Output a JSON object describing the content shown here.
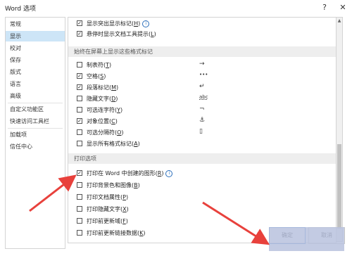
{
  "window": {
    "title": "Word 选项",
    "help": "?",
    "close": "✕"
  },
  "sidebar": {
    "items": [
      {
        "label": "常规"
      },
      {
        "label": "显示"
      },
      {
        "label": "校对"
      },
      {
        "label": "保存"
      },
      {
        "label": "版式"
      },
      {
        "label": "语言"
      },
      {
        "label": "高级"
      },
      {
        "label": "自定义功能区"
      },
      {
        "label": "快速访问工具栏"
      },
      {
        "label": "加载项"
      },
      {
        "label": "信任中心"
      }
    ],
    "selected": "显示"
  },
  "top_rows": [
    {
      "label": "显示突出显示标记(",
      "key": "H",
      "suffix": ")",
      "checked": true,
      "info": "i"
    },
    {
      "label": "悬停时显示文档工具提示(",
      "key": "L",
      "suffix": ")",
      "checked": true
    }
  ],
  "marks_section": {
    "header": "始终在屏幕上显示这些格式标记",
    "rows": [
      {
        "label": "制表符(",
        "key": "T",
        "suffix": ")",
        "checked": false,
        "glyph": "→"
      },
      {
        "label": "空格(",
        "key": "S",
        "suffix": ")",
        "checked": true,
        "glyph": "•••"
      },
      {
        "label": "段落标记(",
        "key": "M",
        "suffix": ")",
        "checked": true,
        "glyph": "↵"
      },
      {
        "label": "隐藏文字(",
        "key": "D",
        "suffix": ")",
        "checked": false,
        "glyph": "abc"
      },
      {
        "label": "可选连字符(",
        "key": "Y",
        "suffix": ")",
        "checked": false,
        "glyph": "¬"
      },
      {
        "label": "对象位置(",
        "key": "C",
        "suffix": ")",
        "checked": true,
        "glyph": "⚓"
      },
      {
        "label": "可选分隔符(",
        "key": "O",
        "suffix": ")",
        "checked": false,
        "glyph": "▯"
      },
      {
        "label": "显示所有格式标记(",
        "key": "A",
        "suffix": ")",
        "checked": false,
        "glyph": ""
      }
    ]
  },
  "print_section": {
    "header": "打印选项",
    "rows": [
      {
        "label": "打印在 Word 中创建的图形(",
        "key": "R",
        "suffix": ")",
        "checked": true,
        "info": "i"
      },
      {
        "label": "打印背景色和图像(",
        "key": "B",
        "suffix": ")",
        "checked": false
      },
      {
        "label": "打印文档属性(",
        "key": "P",
        "suffix": ")",
        "checked": false
      },
      {
        "label": "打印隐藏文字(",
        "key": "X",
        "suffix": ")",
        "checked": false
      },
      {
        "label": "打印前更新域(",
        "key": "F",
        "suffix": ")",
        "checked": false
      },
      {
        "label": "打印前更新链接数据(",
        "key": "K",
        "suffix": ")",
        "checked": false
      }
    ]
  },
  "buttons": {
    "ok": "确定",
    "cancel": "取消"
  },
  "colors": {
    "arrow": "#e8413c",
    "selected_bg": "#cde5f7",
    "overlay": "#b8c2de"
  }
}
